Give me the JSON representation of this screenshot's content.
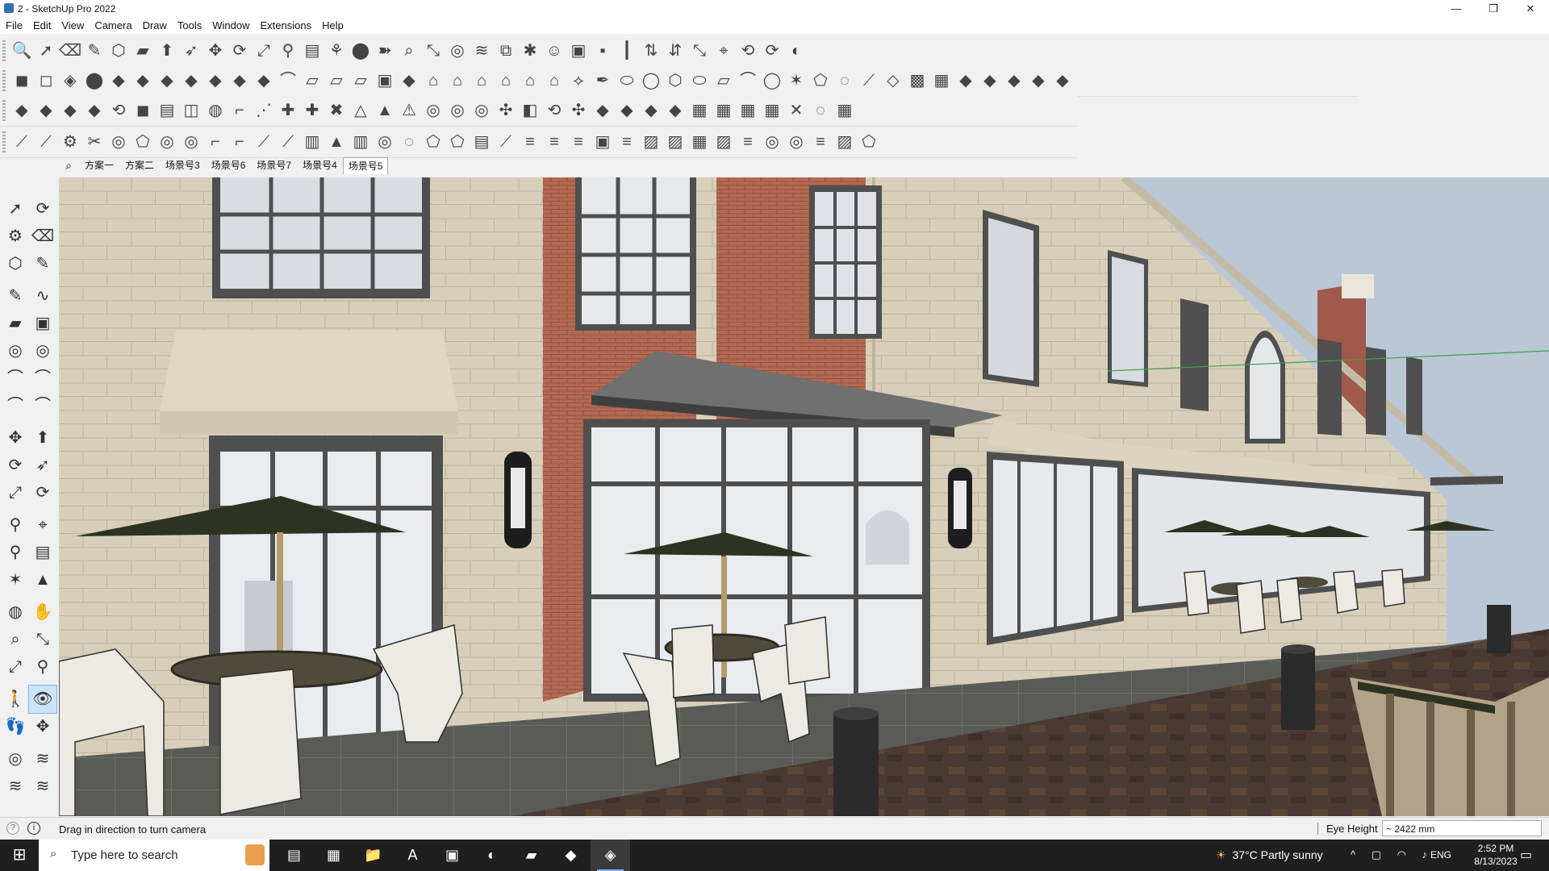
{
  "window": {
    "title": "2 - SketchUp Pro 2022",
    "minimize_icon": "minimize-icon",
    "maximize_icon": "restore-icon",
    "close_icon": "close-icon"
  },
  "menubar": [
    "File",
    "Edit",
    "View",
    "Camera",
    "Draw",
    "Tools",
    "Window",
    "Extensions",
    "Help"
  ],
  "toolbar_rows": [
    [
      "🔍",
      "➚",
      "⌫",
      "✎",
      "⬡",
      "▰",
      "⬆",
      "➶",
      "✥",
      "⟳",
      "⤢",
      "⚲",
      "▤",
      "⚘",
      "⬤",
      "➽",
      "⌕",
      "⤡",
      "◎",
      "≋",
      "⧉",
      "✱",
      "☺",
      "▣",
      "▪",
      "┃",
      "⇅",
      "⇵",
      "⤡",
      "⌖",
      "⟲",
      "⟳",
      "◐"
    ],
    [
      "◼",
      "◻",
      "◈",
      "⬤",
      "◆",
      "◆",
      "◆",
      "◆",
      "◆",
      "◆",
      "◆",
      "⌒",
      "▱",
      "▱",
      "▱",
      "▣",
      "◆",
      "⌂",
      "⌂",
      "⌂",
      "⌂",
      "⌂",
      "⌂",
      "⟡",
      "✒",
      "⬭",
      "◯",
      "⬡",
      "⬭",
      "▱",
      "⌒",
      "◯",
      "✶",
      "⬠",
      "◌",
      "⟋",
      "◇",
      "▩",
      "▦",
      "◆",
      "◆",
      "◆",
      "◆",
      "◆"
    ],
    [
      "◆",
      "◆",
      "◆",
      "◆",
      "⟲",
      "◼",
      "▤",
      "◫",
      "◍",
      "⌐",
      "⋰",
      "✚",
      "✚",
      "✖",
      "△",
      "▲",
      "⚠",
      "◎",
      "◎",
      "◎",
      "✣",
      "◧",
      "⟲",
      "✣",
      "◆",
      "◆",
      "◆",
      "◆",
      "▦",
      "▦",
      "▦",
      "▦",
      "✕",
      "◌",
      "▦"
    ],
    [
      "⟋",
      "⟋",
      "⚙",
      "✂",
      "◎",
      "⬠",
      "◎",
      "◎",
      "⌐",
      "⌐",
      "⟋",
      "⟋",
      "▥",
      "▲",
      "▥",
      "◎",
      "◌",
      "⬠",
      "⬠",
      "▤",
      "⟋",
      "≡",
      "≡",
      "≡",
      "▣",
      "≡",
      "▨",
      "▨",
      "▦",
      "▨",
      "≡",
      "◎",
      "◎",
      "≡",
      "▨",
      "⬠"
    ]
  ],
  "scene_tabs": {
    "search_icon": "search-icon",
    "tabs": [
      "方案一",
      "方案二",
      "场景号3",
      "场景号6",
      "场景号7",
      "场景号4",
      "场景号5"
    ],
    "active_index": 6
  },
  "left_toolbar": [
    [
      "➚",
      "⟳",
      "⚙",
      "⌫",
      "⬡",
      "✎"
    ],
    [
      "✎",
      "∿",
      "▰",
      "▣",
      "◎",
      "◎",
      "⌒",
      "⌒",
      "⌒",
      "⌒"
    ],
    [
      "✥",
      "⬆",
      "⟳",
      "➶",
      "⤢",
      "⟳"
    ],
    [
      "⚲",
      "⌖",
      "⚲",
      "▤",
      "✶",
      "▲"
    ],
    [
      "◍",
      "✋",
      "⌕",
      "⤡",
      "⤢",
      "⚲"
    ],
    [
      "🚶",
      "👁",
      "👣",
      "✥"
    ],
    [
      "◎",
      "≋",
      "≋",
      "≋"
    ]
  ],
  "left_toolbar_active": "👁",
  "statusbar": {
    "help_icon": "?",
    "info_icon": "i",
    "message": "Drag in direction to turn camera",
    "measurement_label": "Eye Height",
    "measurement_value": "~ 2422 mm"
  },
  "taskbar": {
    "search_placeholder": "Type here to search",
    "apps": [
      "task-view",
      "calculator",
      "file-explorer",
      "acrobat",
      "app",
      "edge",
      "sticky-notes",
      "app",
      "sketchup"
    ],
    "app_glyphs": [
      "▤",
      "▦",
      "📁",
      "A",
      "▣",
      "◐",
      "▰",
      "◆",
      "◈"
    ],
    "active_app_index": 8,
    "weather_temp": "37°C",
    "weather_desc": "Partly sunny",
    "tray_glyphs": "^ ▢ ◠ ♪",
    "language": "ENG",
    "time": "2:52 PM",
    "date": "8/13/2023"
  },
  "colors": {
    "title_bg": "#ffffff",
    "toolbar_bg": "#f0f0f0",
    "sky": "#b9c7d6",
    "stone": "#d8cfba",
    "brick": "#b46a52",
    "glass": "#e9ecef",
    "frame": "#5f5f5f",
    "canopy": "#707070",
    "umbrella": "#2c3320",
    "paving": "#5a5a57",
    "brown_paving": "#4a3a33",
    "taskbar_bg": "#1f1f1f",
    "accent": "#7ab4ff"
  }
}
